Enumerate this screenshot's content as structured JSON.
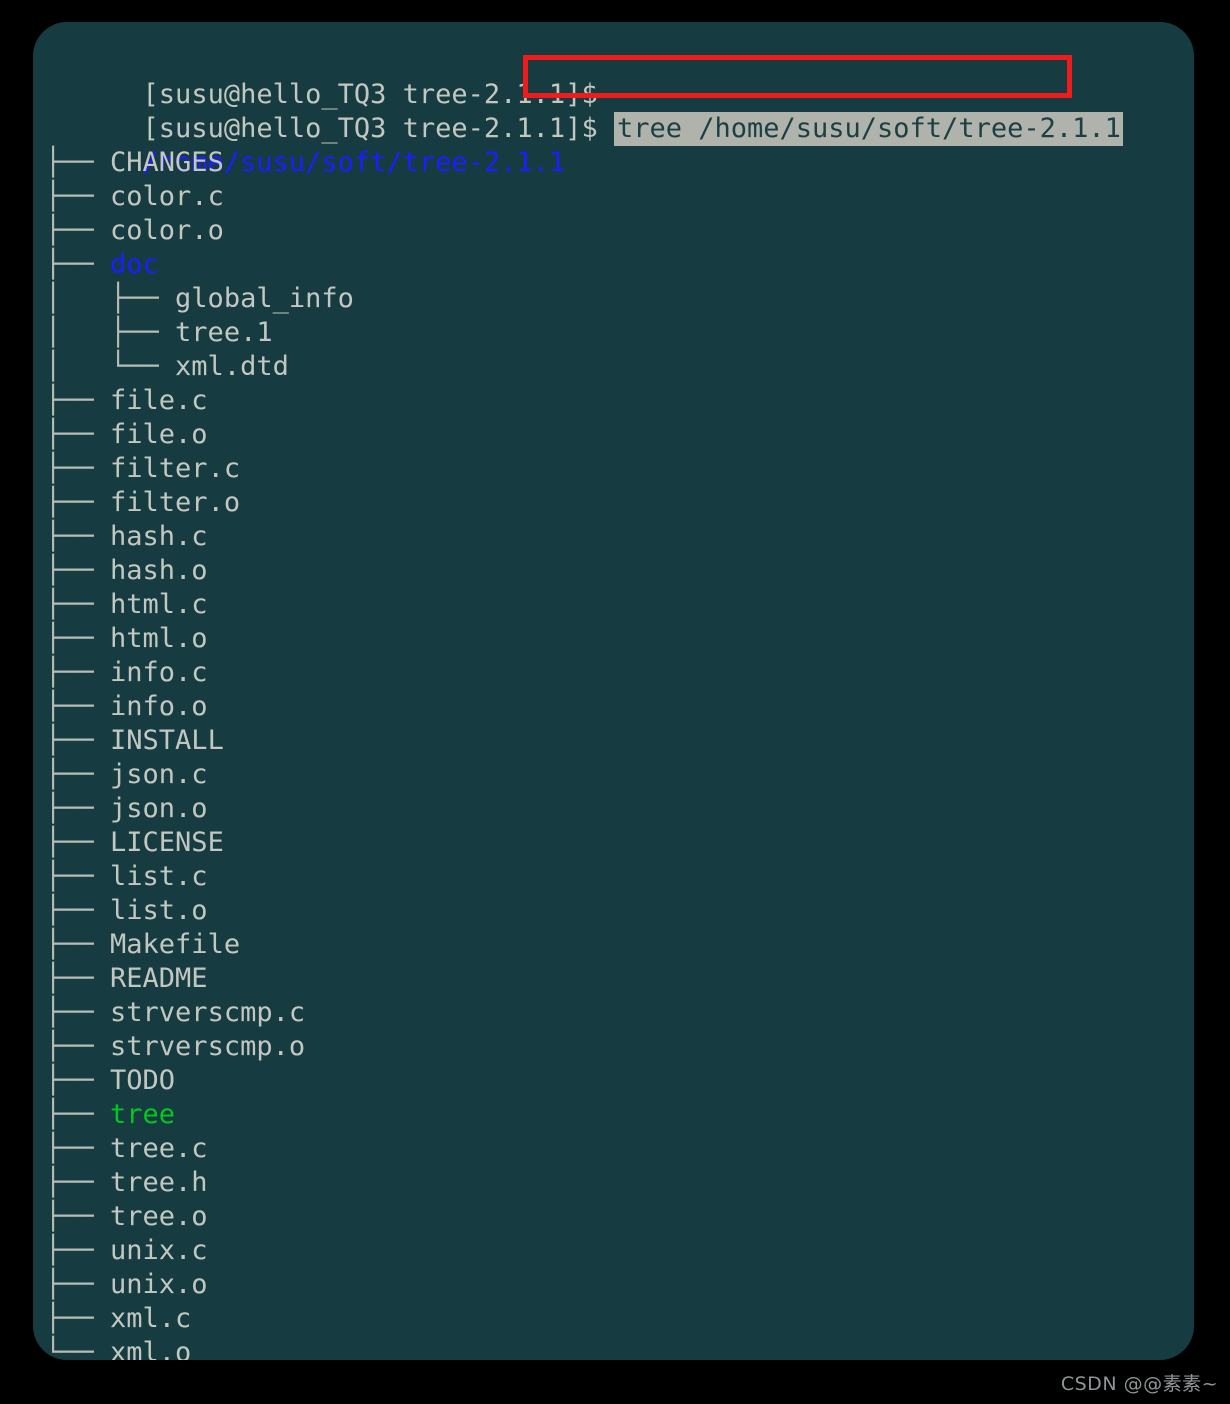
{
  "terminal": {
    "background_color": "#163c41",
    "text_color": "#c3c7c1",
    "dir_color": "#1d1dff",
    "exec_color": "#00c81e",
    "highlight_bg": "#b0b3ac",
    "highlight_fg": "#1c3f44",
    "annotation_color": "#ee1c1c",
    "prompt": "[susu@hello_TQ3 tree-2.1.1]$",
    "lines": {
      "prompt_line_1": "[susu@hello_TQ3 tree-2.1.1]$",
      "prompt_line_2": "[susu@hello_TQ3 tree-2.1.1]$ ",
      "command": "tree /home/susu/soft/tree-2.1.1",
      "root_path": "/home/susu/soft/tree-2.1.1"
    },
    "tree_entries": [
      {
        "prefix": "├── ",
        "name": "CHANGES",
        "kind": "file"
      },
      {
        "prefix": "├── ",
        "name": "color.c",
        "kind": "file"
      },
      {
        "prefix": "├── ",
        "name": "color.o",
        "kind": "file"
      },
      {
        "prefix": "├── ",
        "name": "doc",
        "kind": "dir"
      },
      {
        "prefix": "│   ├── ",
        "name": "global_info",
        "kind": "file"
      },
      {
        "prefix": "│   ├── ",
        "name": "tree.1",
        "kind": "file"
      },
      {
        "prefix": "│   └── ",
        "name": "xml.dtd",
        "kind": "file"
      },
      {
        "prefix": "├── ",
        "name": "file.c",
        "kind": "file"
      },
      {
        "prefix": "├── ",
        "name": "file.o",
        "kind": "file"
      },
      {
        "prefix": "├── ",
        "name": "filter.c",
        "kind": "file"
      },
      {
        "prefix": "├── ",
        "name": "filter.o",
        "kind": "file"
      },
      {
        "prefix": "├── ",
        "name": "hash.c",
        "kind": "file"
      },
      {
        "prefix": "├── ",
        "name": "hash.o",
        "kind": "file"
      },
      {
        "prefix": "├── ",
        "name": "html.c",
        "kind": "file"
      },
      {
        "prefix": "├── ",
        "name": "html.o",
        "kind": "file"
      },
      {
        "prefix": "├── ",
        "name": "info.c",
        "kind": "file"
      },
      {
        "prefix": "├── ",
        "name": "info.o",
        "kind": "file"
      },
      {
        "prefix": "├── ",
        "name": "INSTALL",
        "kind": "file"
      },
      {
        "prefix": "├── ",
        "name": "json.c",
        "kind": "file"
      },
      {
        "prefix": "├── ",
        "name": "json.o",
        "kind": "file"
      },
      {
        "prefix": "├── ",
        "name": "LICENSE",
        "kind": "file"
      },
      {
        "prefix": "├── ",
        "name": "list.c",
        "kind": "file"
      },
      {
        "prefix": "├── ",
        "name": "list.o",
        "kind": "file"
      },
      {
        "prefix": "├── ",
        "name": "Makefile",
        "kind": "file"
      },
      {
        "prefix": "├── ",
        "name": "README",
        "kind": "file"
      },
      {
        "prefix": "├── ",
        "name": "strverscmp.c",
        "kind": "file"
      },
      {
        "prefix": "├── ",
        "name": "strverscmp.o",
        "kind": "file"
      },
      {
        "prefix": "├── ",
        "name": "TODO",
        "kind": "file"
      },
      {
        "prefix": "├── ",
        "name": "tree",
        "kind": "exec"
      },
      {
        "prefix": "├── ",
        "name": "tree.c",
        "kind": "file"
      },
      {
        "prefix": "├── ",
        "name": "tree.h",
        "kind": "file"
      },
      {
        "prefix": "├── ",
        "name": "tree.o",
        "kind": "file"
      },
      {
        "prefix": "├── ",
        "name": "unix.c",
        "kind": "file"
      },
      {
        "prefix": "├── ",
        "name": "unix.o",
        "kind": "file"
      },
      {
        "prefix": "├── ",
        "name": "xml.c",
        "kind": "file"
      },
      {
        "prefix": "└── ",
        "name": "xml.o",
        "kind": "file"
      }
    ]
  },
  "watermark": {
    "text": "CSDN @@素素~"
  }
}
